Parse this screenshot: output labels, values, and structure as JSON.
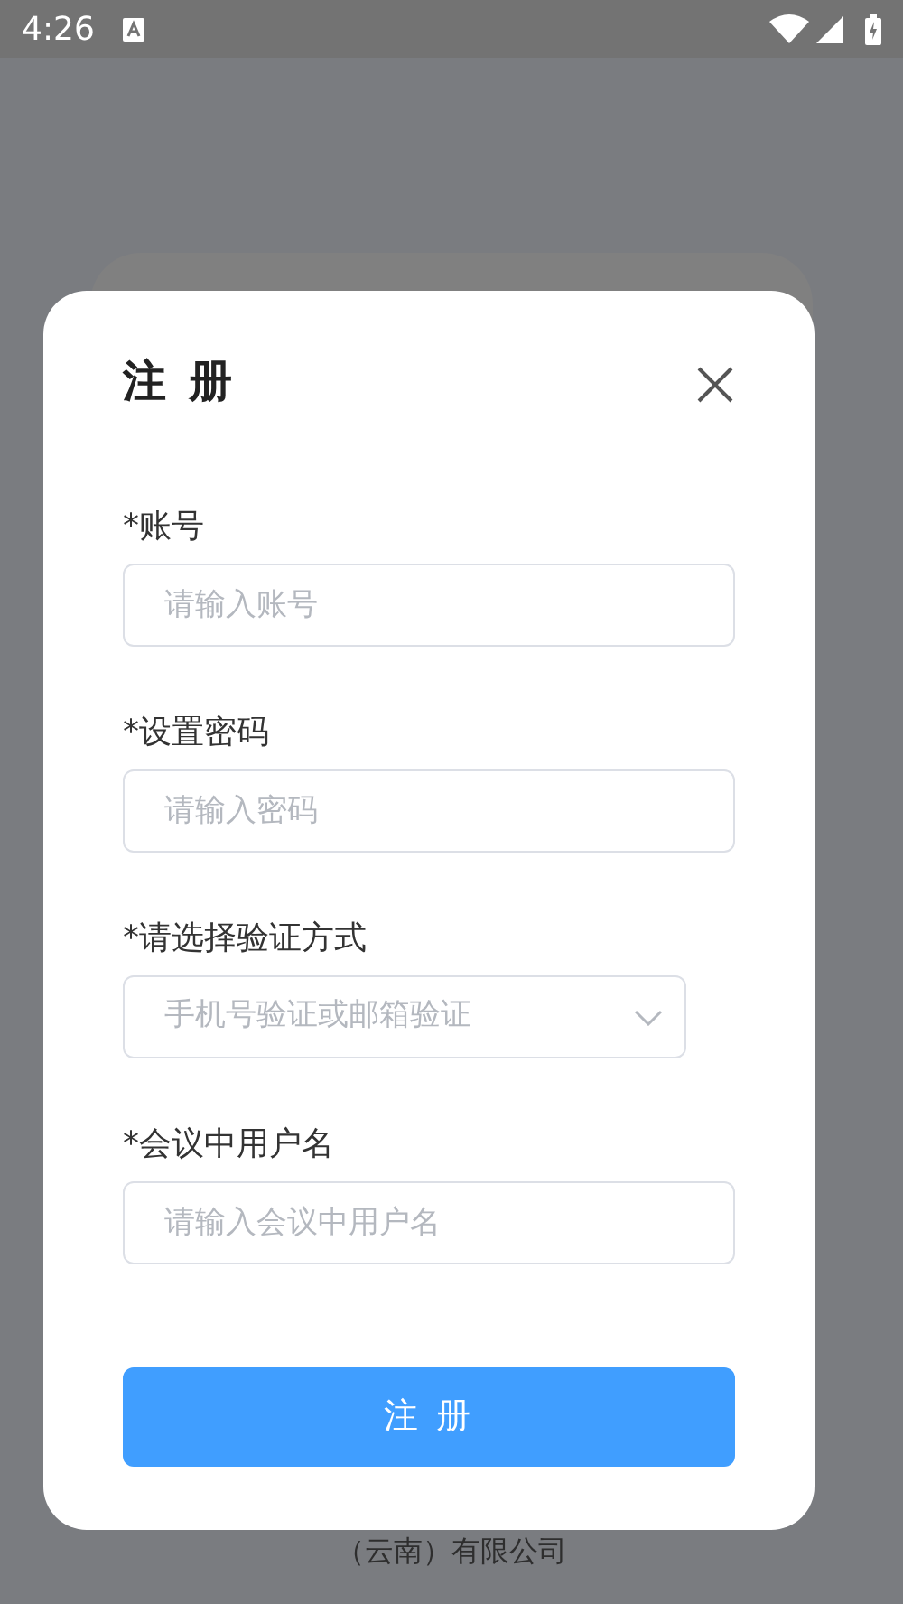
{
  "status_bar": {
    "time": "4:26"
  },
  "dialog": {
    "title": "注 册",
    "fields": [
      {
        "kind": "input",
        "label": "*账号",
        "placeholder": "请输入账号"
      },
      {
        "kind": "input",
        "label": "*设置密码",
        "placeholder": "请输入密码"
      },
      {
        "kind": "select",
        "label": "*请选择验证方式",
        "placeholder": "手机号验证或邮箱验证"
      },
      {
        "kind": "input",
        "label": "*会议中用户名",
        "placeholder": "请输入会议中用户名"
      }
    ],
    "submit": "注 册"
  },
  "footer": "（云南）有限公司"
}
